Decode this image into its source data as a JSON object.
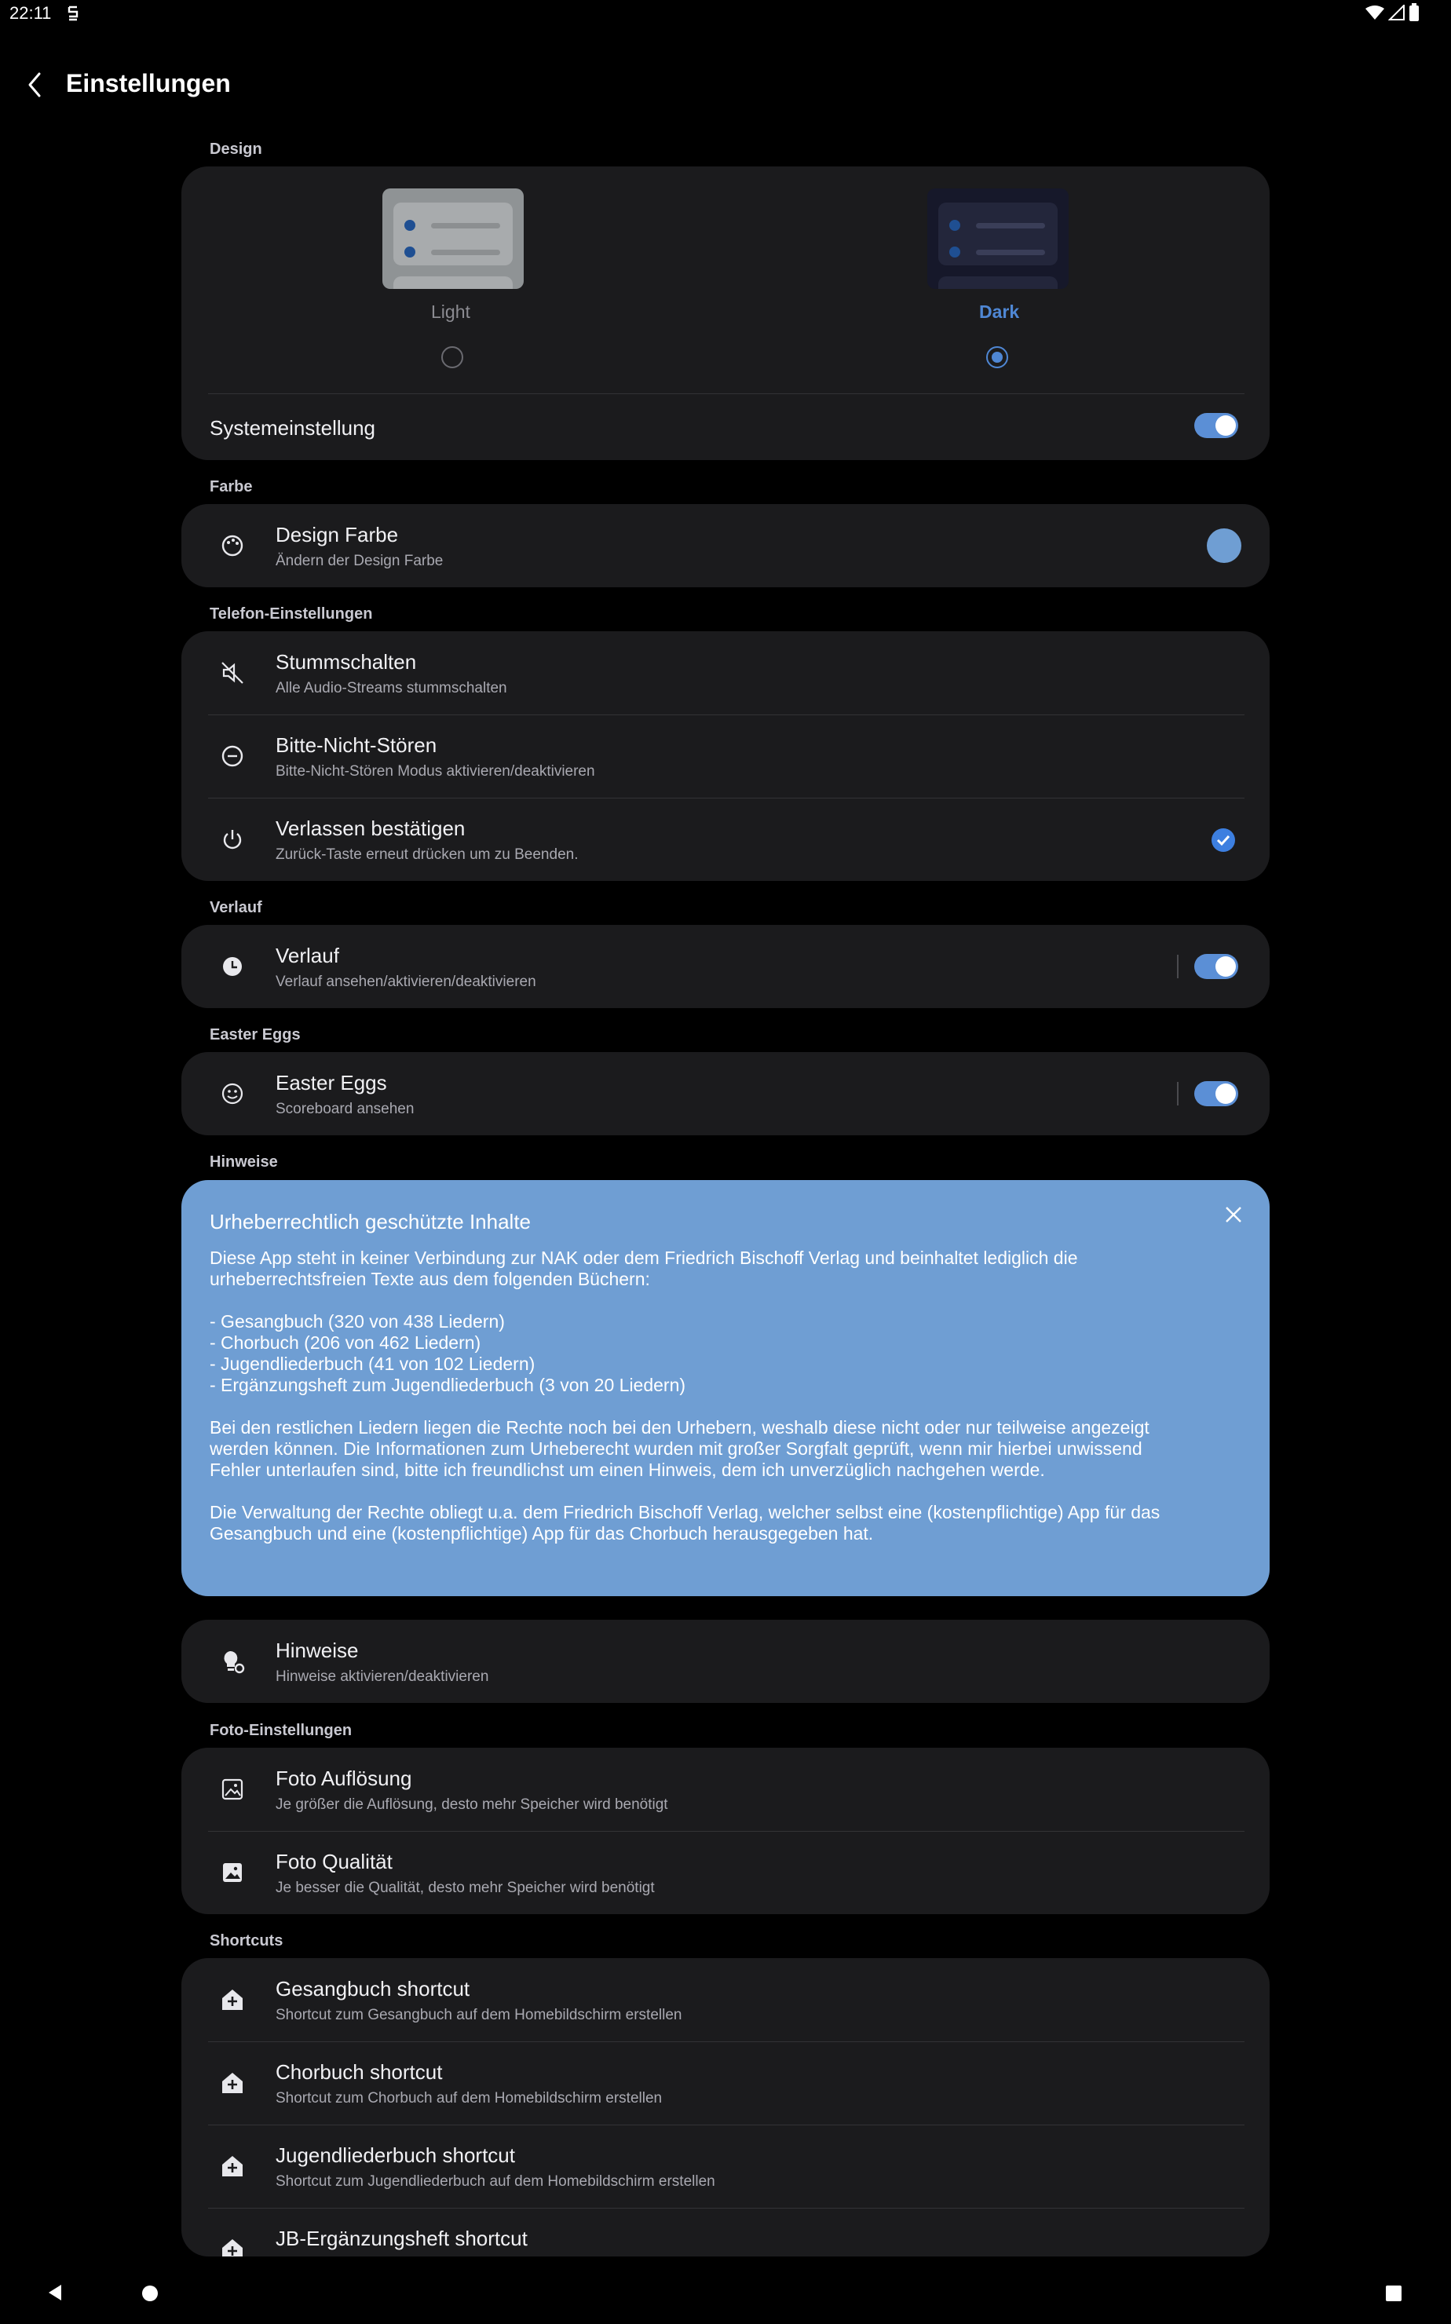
{
  "status": {
    "time": "22:11"
  },
  "header": {
    "title": "Einstellungen"
  },
  "design": {
    "section": "Design",
    "light_label": "Light",
    "dark_label": "Dark",
    "selected": "Dark",
    "system_label": "Systemeinstellung",
    "system_on": true
  },
  "farbe": {
    "section": "Farbe",
    "title": "Design Farbe",
    "subtitle": "Ändern der Design Farbe",
    "swatch": "#6f9ed3"
  },
  "telefon": {
    "section": "Telefon-Einstellungen",
    "items": [
      {
        "title": "Stummschalten",
        "subtitle": "Alle Audio-Streams stummschalten"
      },
      {
        "title": "Bitte-Nicht-Stören",
        "subtitle": "Bitte-Nicht-Stören Modus aktivieren/deaktivieren"
      },
      {
        "title": "Verlassen bestätigen",
        "subtitle": "Zurück-Taste erneut drücken um zu Beenden.",
        "checked": true
      }
    ]
  },
  "verlauf": {
    "section": "Verlauf",
    "title": "Verlauf",
    "subtitle": "Verlauf ansehen/aktivieren/deaktivieren",
    "on": true
  },
  "easter": {
    "section": "Easter Eggs",
    "title": "Easter Eggs",
    "subtitle": "Scoreboard ansehen",
    "on": true
  },
  "hinweise": {
    "section": "Hinweise",
    "note_title": "Urheberrechtlich geschützte Inhalte",
    "note_body": "Diese App steht in keiner Verbindung zur NAK oder dem Friedrich Bischoff Verlag und beinhaltet lediglich die\nurheberrechtsfreien Texte aus dem folgenden Büchern:\n\n- Gesangbuch (320 von 438 Liedern)\n- Chorbuch (206 von 462 Liedern)\n- Jugendliederbuch (41 von 102 Liedern)\n- Ergänzungsheft zum Jugendliederbuch (3 von 20 Liedern)\n\nBei den restlichen Liedern liegen die Rechte noch bei den Urhebern, weshalb diese nicht oder nur teilweise angezeigt\nwerden können. Die Informationen zum Urheberecht wurden mit großer Sorgfalt geprüft, wenn mir hierbei unwissend\nFehler unterlaufen sind, bitte ich freundlichst um einen Hinweis, dem ich unverzüglich nachgehen werde.\n\nDie Verwaltung der Rechte obliegt u.a. dem Friedrich Bischoff Verlag, welcher selbst eine (kostenpflichtige) App für das\nGesangbuch und eine (kostenpflichtige) App für das Chorbuch herausgegeben hat.",
    "title": "Hinweise",
    "subtitle": "Hinweise aktivieren/deaktivieren"
  },
  "foto": {
    "section": "Foto-Einstellungen",
    "items": [
      {
        "title": "Foto Auflösung",
        "subtitle": "Je größer die Auflösung, desto mehr Speicher wird benötigt"
      },
      {
        "title": "Foto Qualität",
        "subtitle": "Je besser die Qualität, desto mehr Speicher wird benötigt"
      }
    ]
  },
  "shortcuts": {
    "section": "Shortcuts",
    "items": [
      {
        "title": "Gesangbuch shortcut",
        "subtitle": "Shortcut zum Gesangbuch auf dem Homebildschirm erstellen"
      },
      {
        "title": "Chorbuch shortcut",
        "subtitle": "Shortcut zum Chorbuch auf dem Homebildschirm erstellen"
      },
      {
        "title": "Jugendliederbuch shortcut",
        "subtitle": "Shortcut zum Jugendliederbuch auf dem Homebildschirm erstellen"
      },
      {
        "title": "JB-Ergänzungsheft shortcut",
        "subtitle": ""
      }
    ]
  },
  "colors": {
    "accent": "#5b8fd6",
    "note_bg": "#6f9ed3",
    "card_bg": "#1b1b1d"
  }
}
